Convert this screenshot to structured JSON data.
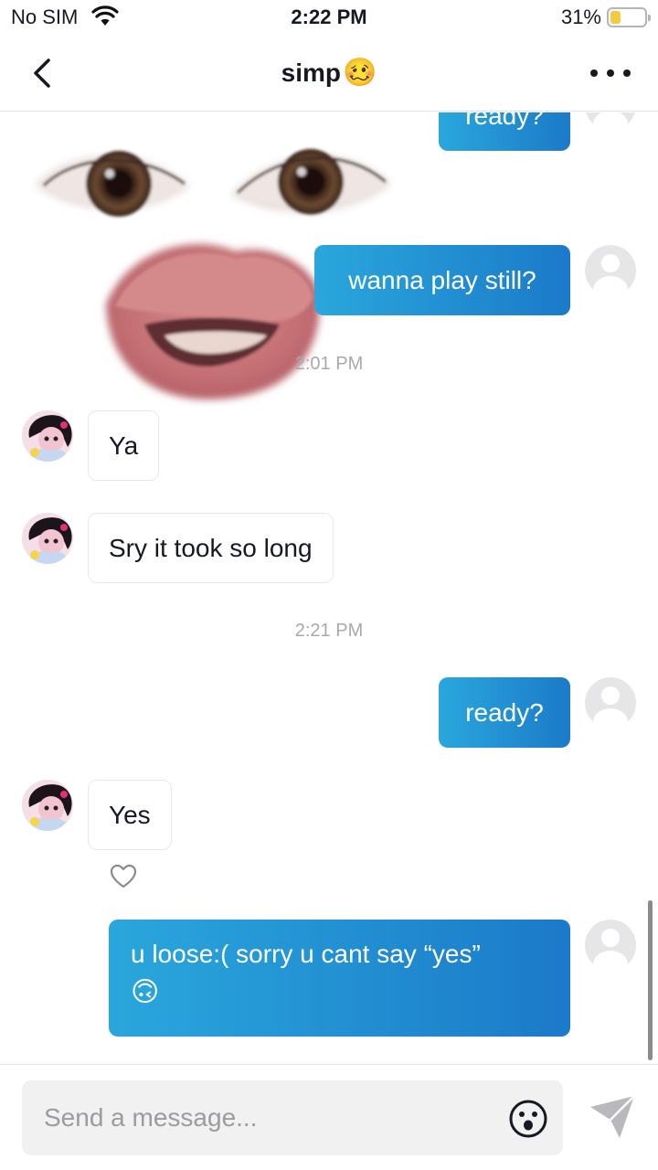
{
  "status_bar": {
    "carrier": "No SIM",
    "time": "2:22 PM",
    "battery_percent": "31%",
    "battery_level": 0.31
  },
  "header": {
    "title": "simp",
    "title_emoji": "🥴"
  },
  "messages": {
    "out_ready_top": "ready?",
    "out_wanna_play": "wanna play still?",
    "ts_1": "2:01 PM",
    "in_ya": "Ya",
    "in_sry": "Sry it took so long",
    "ts_2": "2:21 PM",
    "out_ready": "ready?",
    "in_yes": "Yes",
    "out_loose_text": "u loose:( sorry u cant say “yes”",
    "out_loose_emoji": "🙃"
  },
  "input": {
    "placeholder": "Send a message..."
  },
  "colors": {
    "bubble_gradient_start": "#2aa7dc",
    "bubble_gradient_end": "#1b7ac9",
    "battery_fill": "#f6c945"
  }
}
